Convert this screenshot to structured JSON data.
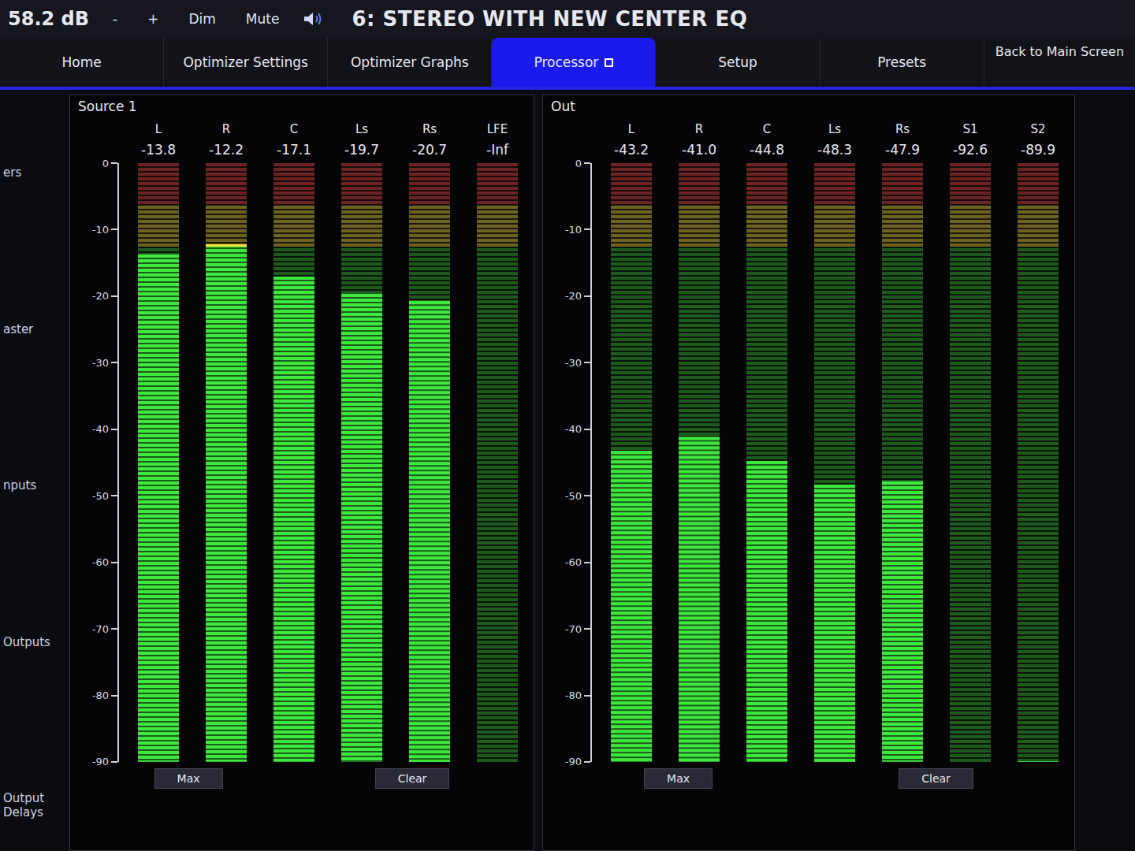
{
  "top_bar": {
    "volume": "58.2 dB",
    "buttons": [
      "-",
      "+",
      "Dim",
      "Mute"
    ],
    "preset_title": "6: STEREO WITH NEW CENTER EQ",
    "back_link": "Back to Main Screen"
  },
  "tabs": [
    {
      "label": "Home",
      "selected": false
    },
    {
      "label": "Optimizer Settings",
      "selected": false
    },
    {
      "label": "Optimizer Graphs",
      "selected": false
    },
    {
      "label": "Processor",
      "selected": true
    },
    {
      "label": "Setup",
      "selected": false
    },
    {
      "label": "Presets",
      "selected": false
    }
  ],
  "sidebar": {
    "items": [
      {
        "label": "ers"
      },
      {
        "label": "aster"
      },
      {
        "label": "nputs"
      },
      {
        "label": "Outputs"
      },
      {
        "label": "Output Delays"
      }
    ]
  },
  "panels": [
    {
      "title": "Source 1",
      "scale": [
        "0",
        "-10",
        "-20",
        "-30",
        "-40",
        "-50",
        "-60",
        "-70",
        "-80",
        "-90"
      ],
      "meters": [
        {
          "name": "L",
          "reading": "-13.8",
          "level": 0.847
        },
        {
          "name": "R",
          "reading": "-12.2",
          "level": 0.864
        },
        {
          "name": "C",
          "reading": "-17.1",
          "level": 0.81
        },
        {
          "name": "Ls",
          "reading": "-19.7",
          "level": 0.781
        },
        {
          "name": "Rs",
          "reading": "-20.7",
          "level": 0.77
        },
        {
          "name": "LFE",
          "reading": "-Inf",
          "level": 0
        }
      ],
      "buttons": [
        "Max",
        "Clear"
      ]
    },
    {
      "title": "Out",
      "scale": [
        "0",
        "-10",
        "-20",
        "-30",
        "-40",
        "-50",
        "-60",
        "-70",
        "-80",
        "-90"
      ],
      "meters": [
        {
          "name": "L",
          "reading": "-43.2",
          "level": 0.52
        },
        {
          "name": "R",
          "reading": "-41.0",
          "level": 0.544
        },
        {
          "name": "C",
          "reading": "-44.8",
          "level": 0.502
        },
        {
          "name": "Ls",
          "reading": "-48.3",
          "level": 0.463
        },
        {
          "name": "Rs",
          "reading": "-47.9",
          "level": 0.468
        },
        {
          "name": "S1",
          "reading": "-92.6",
          "level": 0
        },
        {
          "name": "S2",
          "reading": "-89.9",
          "level": 0.001
        }
      ],
      "buttons": [
        "Max",
        "Clear"
      ]
    }
  ]
}
